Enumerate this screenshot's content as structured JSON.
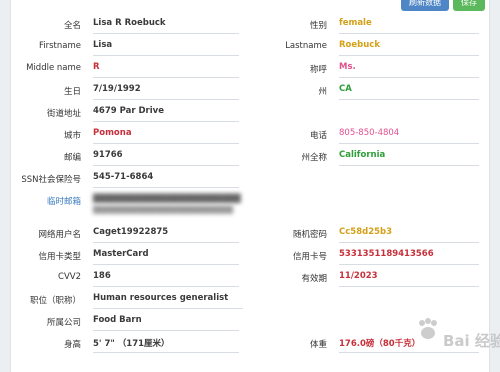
{
  "toolbar": {
    "refresh_label": "刷新数据",
    "save_label": "保存"
  },
  "fields": {
    "full_name": {
      "label": "全名",
      "value": "Lisa R Roebuck"
    },
    "gender": {
      "label": "性别",
      "value": "female"
    },
    "first_name": {
      "label": "Firstname",
      "value": "Lisa"
    },
    "last_name": {
      "label": "Lastname",
      "value": "Roebuck"
    },
    "middle_name": {
      "label": "Middle name",
      "value": "R"
    },
    "title": {
      "label": "称呼",
      "value": "Ms."
    },
    "birthday": {
      "label": "生日",
      "value": "7/19/1992"
    },
    "state": {
      "label": "州",
      "value": "CA"
    },
    "street": {
      "label": "街道地址",
      "value": "4679 Par Drive"
    },
    "city": {
      "label": "城市",
      "value": "Pomona"
    },
    "phone": {
      "label": "电话",
      "value": "805-850-4804"
    },
    "zip": {
      "label": "邮编",
      "value": "91766"
    },
    "state_full": {
      "label": "州全称",
      "value": "California"
    },
    "ssn": {
      "label": "SSN社会保险号",
      "value": "545-71-6864"
    },
    "temp_email": {
      "label": "临时邮箱"
    },
    "username": {
      "label": "网络用户名",
      "value": "Caget19922875"
    },
    "password": {
      "label": "随机密码",
      "value": "Cc58d25b3"
    },
    "card_type": {
      "label": "信用卡类型",
      "value": "MasterCard"
    },
    "card_number": {
      "label": "信用卡号",
      "value": "5331351189413566"
    },
    "cvv2": {
      "label": "CVV2",
      "value": "186"
    },
    "expiry": {
      "label": "有效期",
      "value": "11/2023"
    },
    "occupation": {
      "label": "职位（职称）",
      "value": "Human resources generalist"
    },
    "company": {
      "label": "所属公司",
      "value": "Food Barn"
    },
    "height": {
      "label": "身高",
      "value": "5' 7\"  （171厘米）"
    },
    "weight": {
      "label": "体重",
      "value": "176.0磅（80千克）"
    }
  },
  "watermark": {
    "text": "Bai 经验"
  }
}
